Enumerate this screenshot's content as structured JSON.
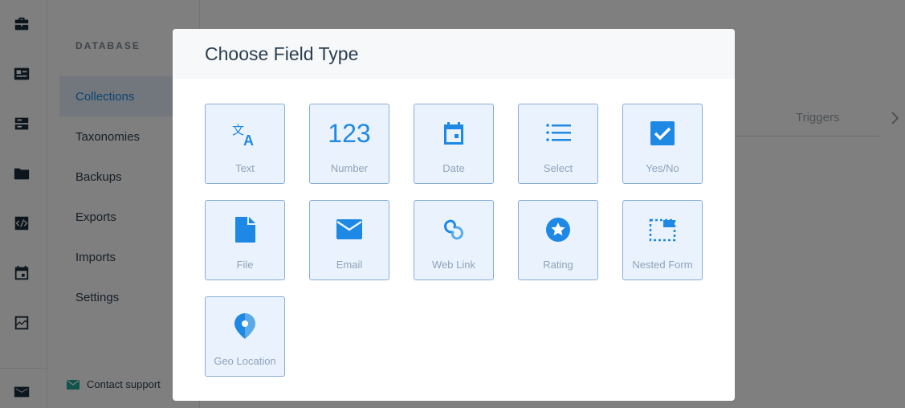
{
  "sidebar": {
    "heading": "DATABASE",
    "items": [
      {
        "label": "Collections",
        "active": true
      },
      {
        "label": "Taxonomies",
        "active": false
      },
      {
        "label": "Backups",
        "active": false
      },
      {
        "label": "Exports",
        "active": false
      },
      {
        "label": "Imports",
        "active": false
      },
      {
        "label": "Settings",
        "active": false
      }
    ],
    "support_label": "Contact support"
  },
  "rail": {
    "icons": [
      "briefcase-icon",
      "id-card-icon",
      "database-icon",
      "folder-icon",
      "code-icon",
      "calendar-icon",
      "chart-icon"
    ],
    "bottom_icon": "mail-icon"
  },
  "background": {
    "tab_triggers": "Triggers"
  },
  "modal": {
    "title": "Choose Field Type",
    "field_types": [
      {
        "label": "Text",
        "icon": "translate-icon"
      },
      {
        "label": "Number",
        "icon": "number-icon",
        "glyph": "123"
      },
      {
        "label": "Date",
        "icon": "calendar-icon"
      },
      {
        "label": "Select",
        "icon": "list-icon"
      },
      {
        "label": "Yes/No",
        "icon": "checkbox-icon"
      },
      {
        "label": "File",
        "icon": "file-icon"
      },
      {
        "label": "Email",
        "icon": "email-icon"
      },
      {
        "label": "Web Link",
        "icon": "link-icon"
      },
      {
        "label": "Rating",
        "icon": "star-icon"
      },
      {
        "label": "Nested Form",
        "icon": "nested-form-icon"
      },
      {
        "label": "Geo Location",
        "icon": "map-pin-icon"
      }
    ]
  },
  "colors": {
    "accent": "#1e88e5",
    "tile_bg": "#eaf3fd",
    "tile_border": "#86aed8",
    "overlay": "rgba(0,0,0,0.5)"
  }
}
